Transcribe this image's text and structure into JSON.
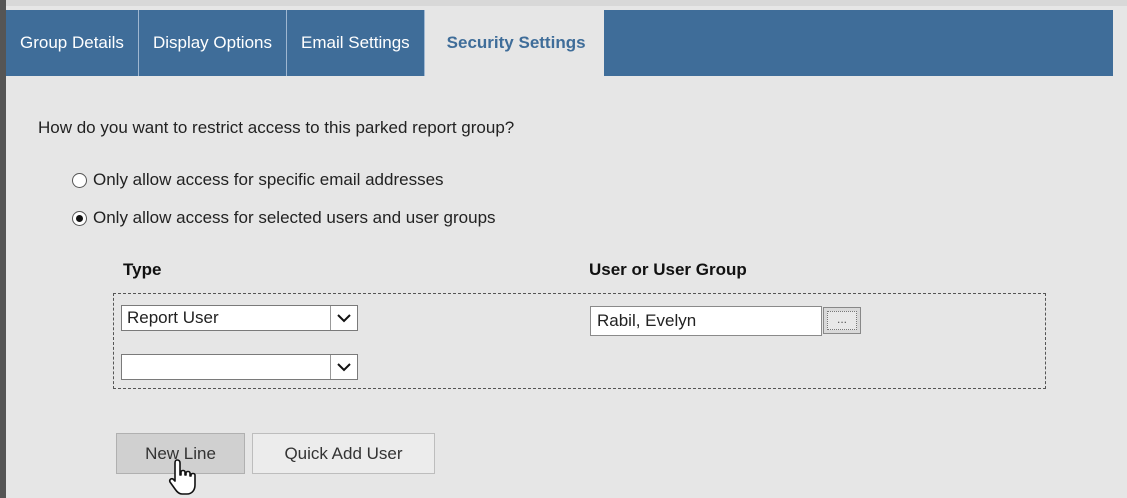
{
  "tabs": [
    {
      "label": "Group Details",
      "active": false
    },
    {
      "label": "Display Options",
      "active": false
    },
    {
      "label": "Email Settings",
      "active": false
    },
    {
      "label": "Security Settings",
      "active": true
    }
  ],
  "colors": {
    "tabbar": "#3f6d99",
    "panel_bg": "#e6e6e6",
    "active_tab_text": "#3f6d99"
  },
  "security": {
    "question": "How do you want to restrict access to this parked report group?",
    "options": [
      {
        "label": "Only allow access for specific email addresses",
        "checked": false
      },
      {
        "label": "Only allow access for selected users and user groups",
        "checked": true
      }
    ]
  },
  "table": {
    "headers": {
      "type": "Type",
      "user_or_group": "User or User Group"
    },
    "rows": [
      {
        "type": "Report User",
        "user": "Rabil, Evelyn",
        "lookup_button": "..."
      },
      {
        "type": "",
        "user": ""
      }
    ]
  },
  "buttons": {
    "new_line": "New Line",
    "quick_add_user": "Quick Add User"
  },
  "icons": {
    "select_arrow": "chevron-down-icon",
    "cursor": "hand-pointer-icon",
    "radio": "radio-button-icon"
  }
}
